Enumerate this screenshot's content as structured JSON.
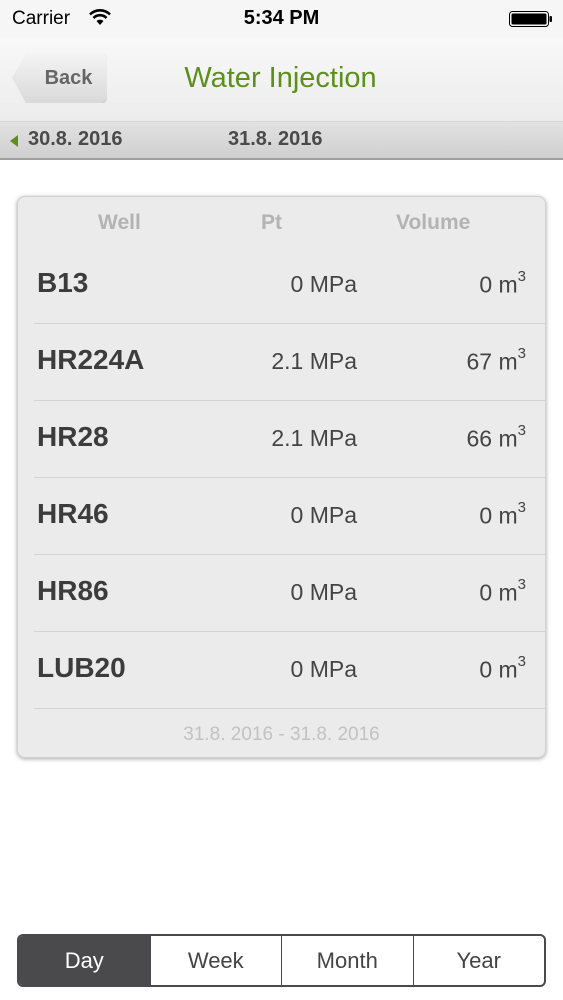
{
  "status_bar": {
    "carrier": "Carrier",
    "time": "5:34 PM"
  },
  "nav": {
    "back_label": "Back",
    "title": "Water Injection",
    "title_color": "#5c8f1e"
  },
  "date_bar": {
    "prev_date": "30.8. 2016",
    "current_date": "31.8. 2016"
  },
  "table": {
    "headers": {
      "well": "Well",
      "pt": "Pt",
      "volume": "Volume"
    },
    "rows": [
      {
        "well": "B13",
        "pt": "0 MPa",
        "volume": "0 m",
        "unit_exp": "3"
      },
      {
        "well": "HR224A",
        "pt": "2.1 MPa",
        "volume": "67 m",
        "unit_exp": "3"
      },
      {
        "well": "HR28",
        "pt": "2.1 MPa",
        "volume": "66 m",
        "unit_exp": "3"
      },
      {
        "well": "HR46",
        "pt": "0 MPa",
        "volume": "0 m",
        "unit_exp": "3"
      },
      {
        "well": "HR86",
        "pt": "0 MPa",
        "volume": "0 m",
        "unit_exp": "3"
      },
      {
        "well": "LUB20",
        "pt": "0 MPa",
        "volume": "0 m",
        "unit_exp": "3"
      }
    ],
    "range": "31.8. 2016 - 31.8. 2016"
  },
  "period_selector": {
    "options": [
      "Day",
      "Week",
      "Month",
      "Year"
    ],
    "selected": "Day"
  }
}
